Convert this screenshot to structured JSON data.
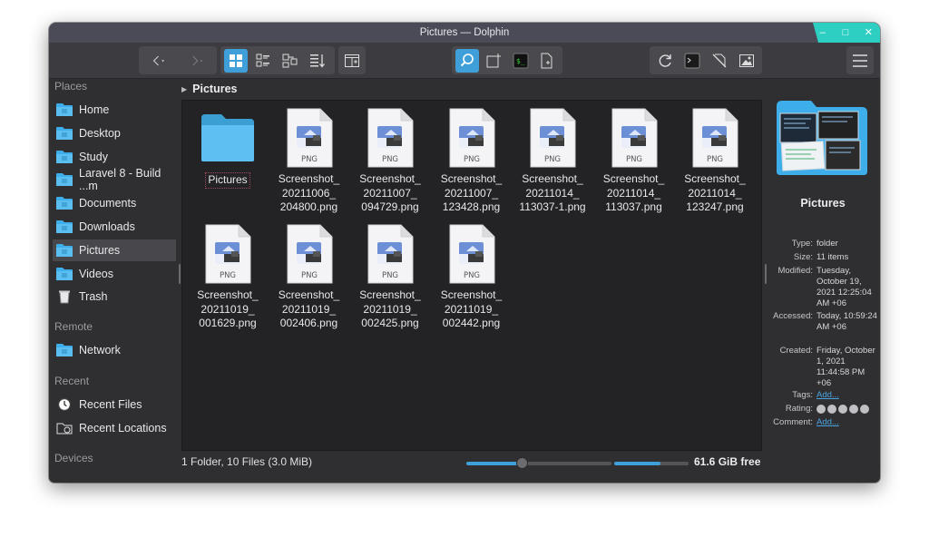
{
  "window": {
    "title": "Pictures — Dolphin",
    "controls": {
      "minimize": "–",
      "maximize": "□",
      "close": "✕"
    }
  },
  "toolbar": {
    "icons": [
      "back-icon",
      "forward-icon",
      "icons-view-icon",
      "details-view-icon",
      "compact-view-icon",
      "sort-icon",
      "split-view-icon",
      "search-icon",
      "new-tab-icon",
      "terminal-icon",
      "new-file-icon",
      "reload-icon",
      "terminal-panel-icon",
      "hidden-files-icon",
      "preview-icon",
      "menu-icon"
    ],
    "accent": "#3f9fd8"
  },
  "sidebar": {
    "places_title": "Places",
    "places": [
      {
        "label": "Home",
        "icon": "home-folder-icon"
      },
      {
        "label": "Desktop",
        "icon": "desktop-folder-icon"
      },
      {
        "label": "Study",
        "icon": "folder-icon"
      },
      {
        "label": "Laravel 8 - Build ...m",
        "icon": "folder-icon"
      },
      {
        "label": "Documents",
        "icon": "documents-folder-icon"
      },
      {
        "label": "Downloads",
        "icon": "downloads-folder-icon"
      },
      {
        "label": "Pictures",
        "icon": "pictures-folder-icon",
        "selected": true
      },
      {
        "label": "Videos",
        "icon": "videos-folder-icon"
      },
      {
        "label": "Trash",
        "icon": "trash-icon"
      }
    ],
    "remote_title": "Remote",
    "remote": [
      {
        "label": "Network",
        "icon": "network-folder-icon"
      }
    ],
    "recent_title": "Recent",
    "recent": [
      {
        "label": "Recent Files",
        "icon": "clock-icon"
      },
      {
        "label": "Recent Locations",
        "icon": "recent-locations-icon"
      }
    ],
    "devices_title": "Devices"
  },
  "breadcrumb": {
    "current": "Pictures"
  },
  "files": [
    {
      "name": "Pictures",
      "type": "folder"
    },
    {
      "name": "Screenshot_20211006_204800.png",
      "lines": [
        "Screenshot_",
        "20211006_",
        "204800.png"
      ],
      "type": "png"
    },
    {
      "name": "Screenshot_20211007_094729.png",
      "lines": [
        "Screenshot_",
        "20211007_",
        "094729.png"
      ],
      "type": "png"
    },
    {
      "name": "Screenshot_20211007_123428.png",
      "lines": [
        "Screenshot_",
        "20211007_",
        "123428.png"
      ],
      "type": "png"
    },
    {
      "name": "Screenshot_20211014_113037-1.png",
      "lines": [
        "Screenshot_",
        "20211014_",
        "113037-1.png"
      ],
      "type": "png"
    },
    {
      "name": "Screenshot_20211014_113037.png",
      "lines": [
        "Screenshot_",
        "20211014_",
        "113037.png"
      ],
      "type": "png"
    },
    {
      "name": "Screenshot_20211014_123247.png",
      "lines": [
        "Screenshot_",
        "20211014_",
        "123247.png"
      ],
      "type": "png"
    },
    {
      "name": "Screenshot_20211019_001629.png",
      "lines": [
        "Screenshot_",
        "20211019_",
        "001629.png"
      ],
      "type": "png"
    },
    {
      "name": "Screenshot_20211019_002406.png",
      "lines": [
        "Screenshot_",
        "20211019_",
        "002406.png"
      ],
      "type": "png"
    },
    {
      "name": "Screenshot_20211019_002425.png",
      "lines": [
        "Screenshot_",
        "20211019_",
        "002425.png"
      ],
      "type": "png"
    },
    {
      "name": "Screenshot_20211019_002442.png",
      "lines": [
        "Screenshot_",
        "20211019_",
        "002442.png"
      ],
      "type": "png"
    }
  ],
  "file_badge": "PNG",
  "statusbar": {
    "summary": "1 Folder, 10 Files (3.0 MiB)",
    "zoom_fraction": 0.38,
    "disk_used_fraction": 0.62,
    "free_space": "61.6 GiB free"
  },
  "info_panel": {
    "title": "Pictures",
    "rows": [
      {
        "key": "Type:",
        "value": "folder"
      },
      {
        "key": "Size:",
        "value": "11 items"
      },
      {
        "key": "Modified:",
        "value": "Tuesday, October 19, 2021 12:25:04 AM +06"
      },
      {
        "key": "Accessed:",
        "value": "Today, 10:59:24 AM +06"
      },
      {
        "key": "Created:",
        "value": "Friday, October 1, 2021 11:44:58 PM +06"
      },
      {
        "key": "Tags:",
        "value": "Add..."
      },
      {
        "key": "Rating:",
        "value": ""
      },
      {
        "key": "Comment:",
        "value": "Add..."
      }
    ],
    "rating_stars": 5
  }
}
